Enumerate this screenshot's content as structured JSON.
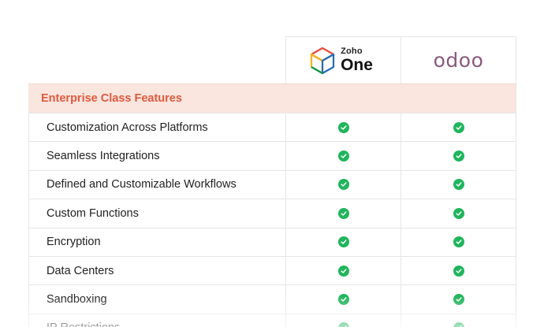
{
  "header": {
    "zoho": {
      "brand": "Zoho",
      "product": "One"
    },
    "odoo": {
      "logo_text": "odoo"
    }
  },
  "section": {
    "title": "Enterprise Class Features"
  },
  "rows": [
    {
      "label": "Customization Across Platforms",
      "zoho": "check",
      "odoo": "check"
    },
    {
      "label": "Seamless Integrations",
      "zoho": "check",
      "odoo": "check"
    },
    {
      "label": "Defined and Customizable Workflows",
      "zoho": "check",
      "odoo": "check"
    },
    {
      "label": "Custom Functions",
      "zoho": "check",
      "odoo": "check"
    },
    {
      "label": "Encryption",
      "zoho": "check",
      "odoo": "check"
    },
    {
      "label": "Data Centers",
      "zoho": "check",
      "odoo": "check"
    },
    {
      "label": "Sandboxing",
      "zoho": "check",
      "odoo": "check"
    },
    {
      "label": "IP Restrictions",
      "zoho": "check",
      "odoo": "check"
    }
  ],
  "colors": {
    "accent": "#e05a3c",
    "section_bg": "#fbe5df",
    "check": "#20b55c",
    "odoo_purple": "#8a5a7e"
  }
}
